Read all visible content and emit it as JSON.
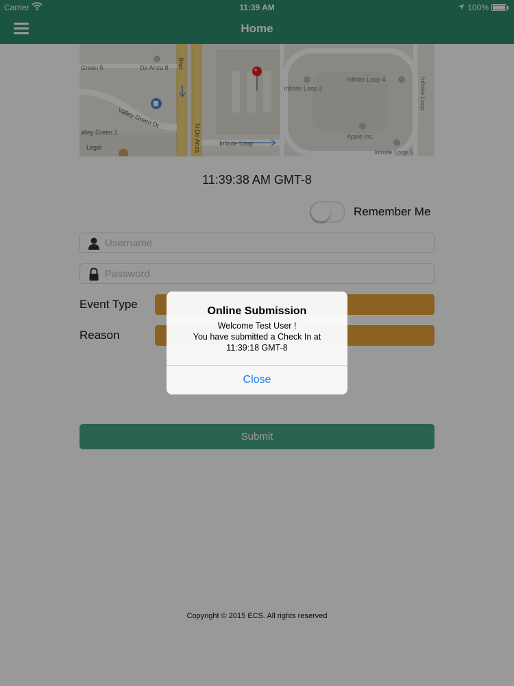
{
  "status_bar": {
    "carrier": "Carrier",
    "time": "11:39 AM",
    "battery": "100%"
  },
  "nav": {
    "title": "Home",
    "menu_icon": "hamburger-menu-icon"
  },
  "map": {
    "labels": {
      "green5": "Green 5",
      "deanza8": "De Anza 8",
      "blvd": "Blvd",
      "infinite2": "Infinite Loop 2",
      "infinite4": "Infinite Loop 4",
      "infinite_loop_v": "Infinite Loop",
      "valley_green_dt": "Valley Green Dt",
      "alley_green1": "alley Green 1",
      "legal": "Legal",
      "n_de_anza": "N De Anza",
      "infinite_loop_road": "Infinite Loop",
      "apple_inc": "Apple Inc.",
      "infinite5": "Infinite Loop 5"
    }
  },
  "clock": "11:39:38 AM GMT-8",
  "remember_me": {
    "label": "Remember Me",
    "on": false
  },
  "login": {
    "username_placeholder": "Username",
    "password_placeholder": "Password"
  },
  "form": {
    "event_type_label": "Event Type",
    "reason_label": "Reason"
  },
  "submit_label": "Submit",
  "copyright": "Copyright © 2015 ECS. All rights reserved",
  "alert": {
    "title": "Online Submission",
    "line1": "Welcome Test User !",
    "line2": "You have submitted a Check In at",
    "line3": "11:39:18 GMT-8",
    "button": "Close"
  },
  "colors": {
    "nav": "#2f8d70",
    "dropdown": "#e8a23a",
    "submit": "#46a582",
    "alert_button": "#1a7cf0"
  }
}
